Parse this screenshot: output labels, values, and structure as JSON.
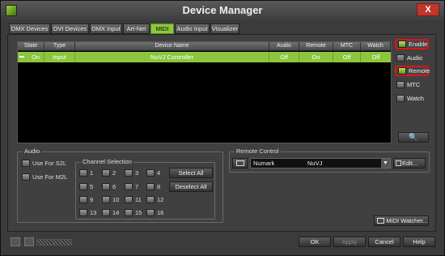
{
  "window": {
    "title": "Device Manager",
    "close_label": "X"
  },
  "tabs": [
    {
      "label": "DMX Devices"
    },
    {
      "label": "DVI Devices"
    },
    {
      "label": "DMX Input"
    },
    {
      "label": "Art-Net"
    },
    {
      "label": "MIDI",
      "active": true
    },
    {
      "label": "Audio Input"
    },
    {
      "label": "Visualizer"
    }
  ],
  "table": {
    "columns": [
      "State",
      "Type",
      "Device Name",
      "Audio",
      "Remote",
      "MTC",
      "Watch"
    ],
    "rows": [
      {
        "state": "On",
        "type": "Input",
        "device_name": "NuVJ Controller",
        "audio": "Off",
        "remote": "On",
        "mtc": "Off",
        "watch": "Off"
      }
    ]
  },
  "side_buttons": {
    "enable": "Enable",
    "audio": "Audio",
    "remote": "Remote",
    "mtc": "MTC",
    "watch": "Watch",
    "search_icon": "🔍"
  },
  "audio_group": {
    "title": "Audio",
    "use_s2l": "Use For S2L",
    "use_m2l": "Use For M2L",
    "channel_selection": {
      "title": "Channel Selection",
      "channels": [
        "1",
        "2",
        "3",
        "4",
        "5",
        "6",
        "7",
        "8",
        "9",
        "10",
        "11",
        "12",
        "13",
        "14",
        "15",
        "16"
      ],
      "select_all": "Select All",
      "deselect_all": "Deselect All"
    }
  },
  "remote_control": {
    "title": "Remote Control",
    "manufacturer": "Numark",
    "model": "NuVJ",
    "edit_label": "Edit..."
  },
  "midi_watcher": "MIDI Watcher...",
  "footer": {
    "ok": "OK",
    "apply": "Apply",
    "cancel": "Cancel",
    "help": "Help"
  },
  "colors": {
    "accent": "#8cc63f",
    "highlight": "#e01414",
    "background": "#3b3b3b"
  }
}
